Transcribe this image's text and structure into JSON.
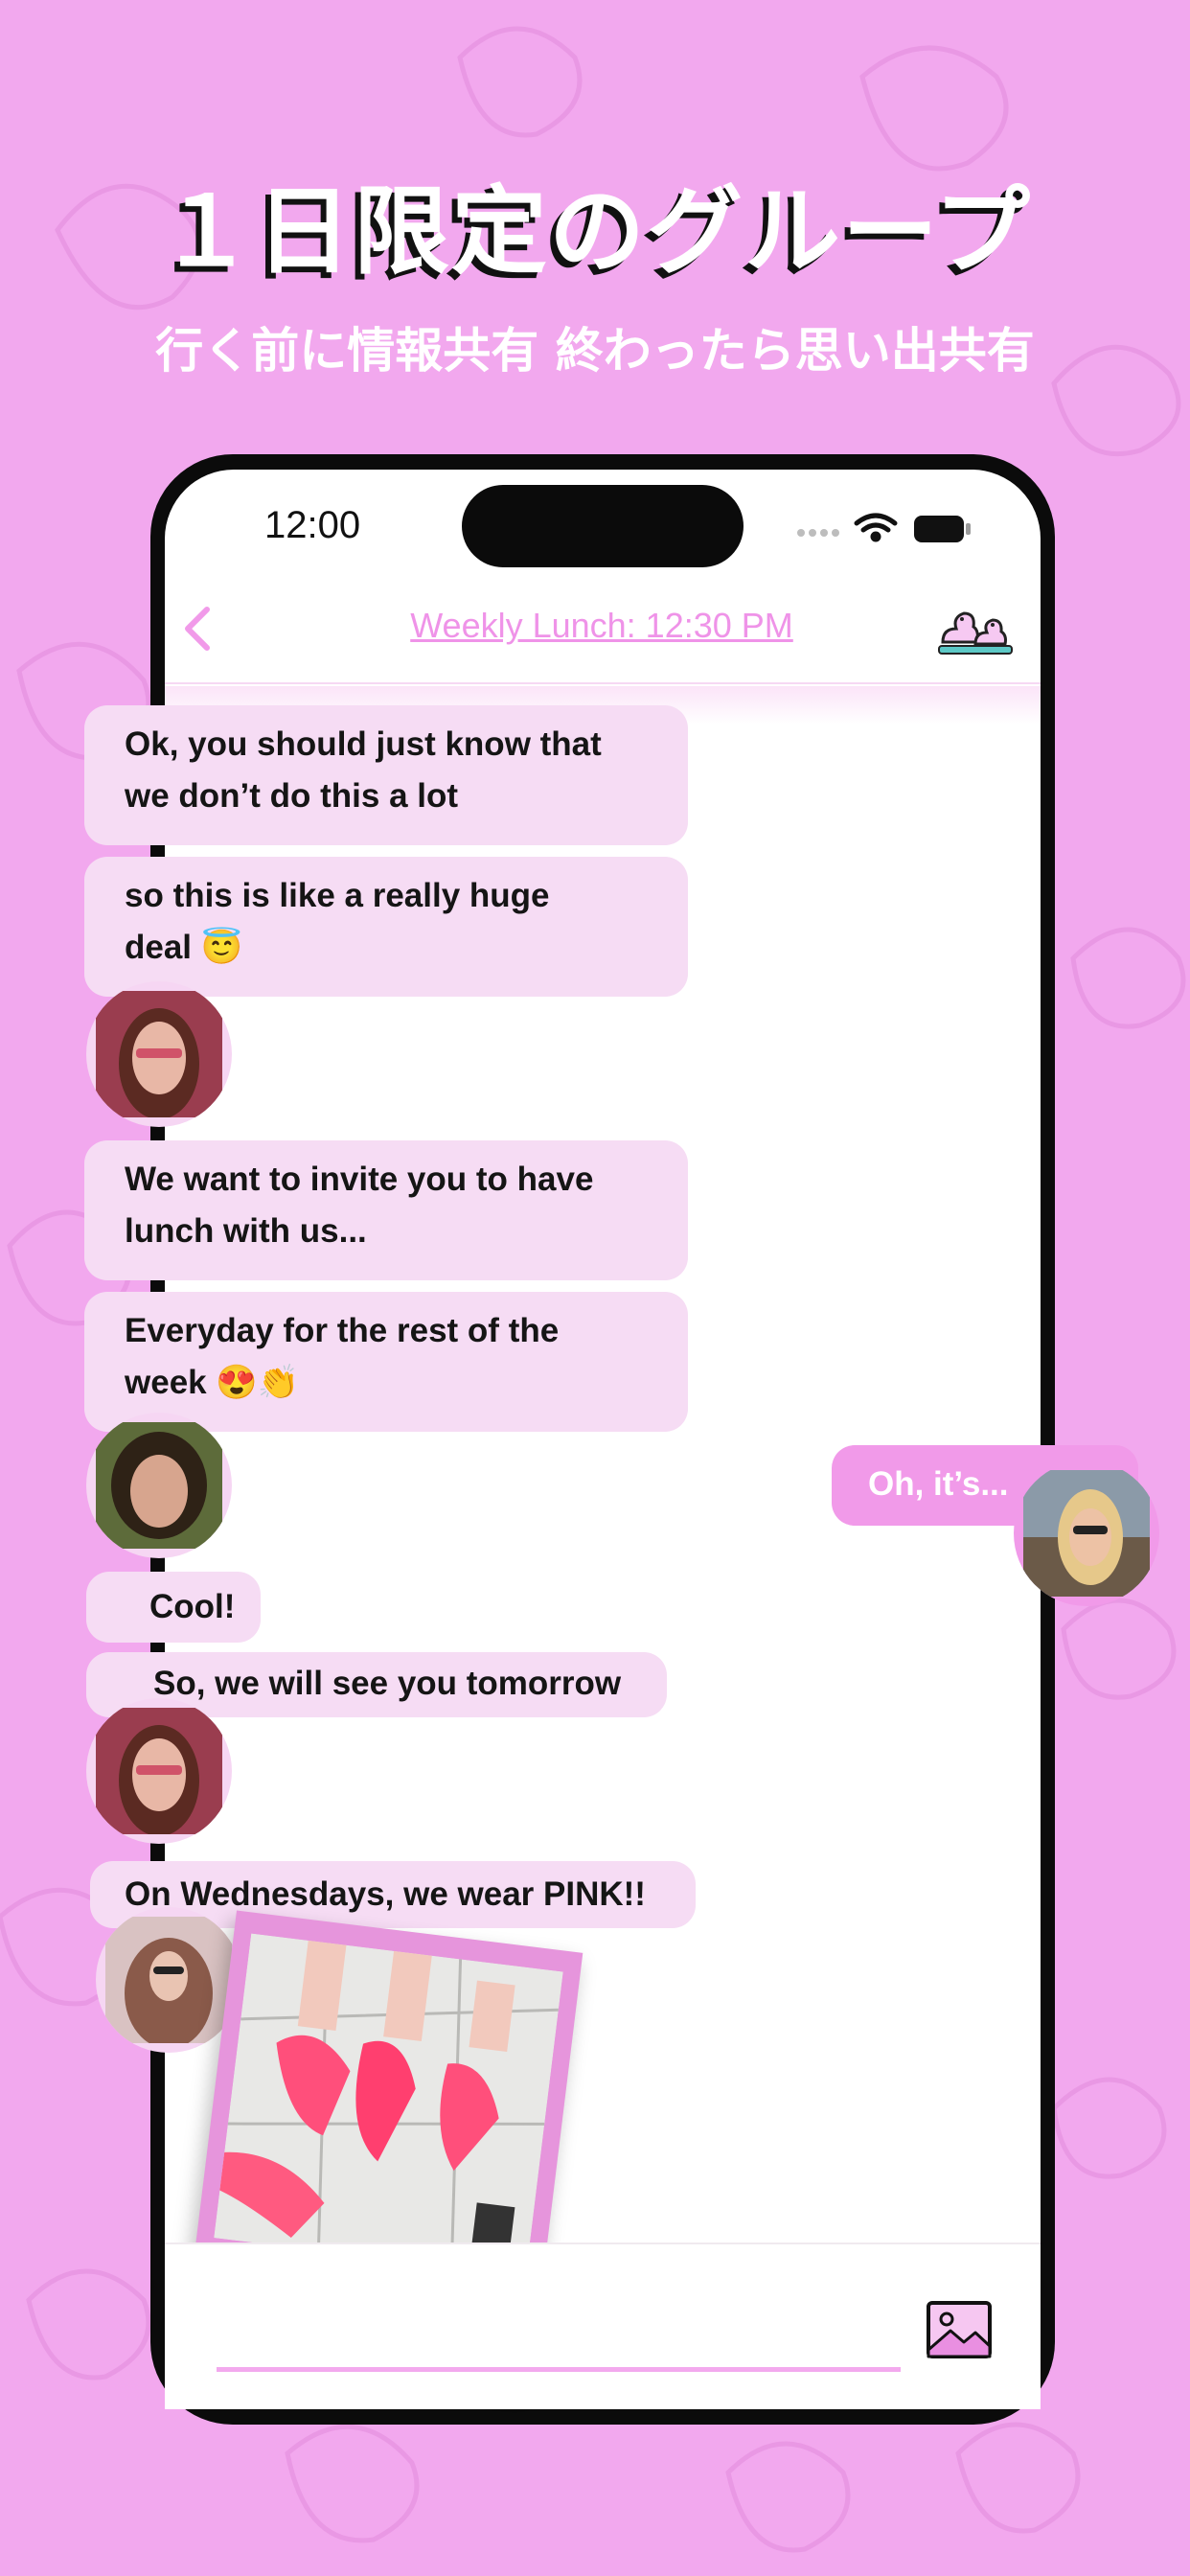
{
  "headline": "１日限定のグループ",
  "subline": "行く前に情報共有 終わったら思い出共有",
  "status_bar": {
    "time": "12:00"
  },
  "nav": {
    "title": "Weekly Lunch: 12:30 PM"
  },
  "messages": [
    {
      "lines": [
        "Ok, you should just know that",
        "we don’t do this a lot"
      ]
    },
    {
      "lines": [
        "so this is like a really huge",
        "deal 😇"
      ]
    },
    {
      "lines": [
        "We want to invite you to have",
        "lunch with us..."
      ]
    },
    {
      "lines": [
        "Everyday for the rest of the",
        "week 😍👏"
      ]
    },
    {
      "lines": [
        "Cool!"
      ]
    },
    {
      "lines": [
        "So, we will see you tomorrow"
      ]
    },
    {
      "lines": [
        "On Wednesdays, we wear PINK!!"
      ]
    }
  ],
  "outgoing": {
    "text": "Oh, it’s..."
  },
  "colors": {
    "background": "#f2a8ee",
    "accent": "#ef93e8",
    "bubble_incoming": "#f6dcf4",
    "bubble_outgoing": "#f19ae9"
  },
  "icons": [
    "chevron-left-icon",
    "ducks-icon",
    "wifi-icon",
    "battery-icon",
    "image-icon"
  ]
}
